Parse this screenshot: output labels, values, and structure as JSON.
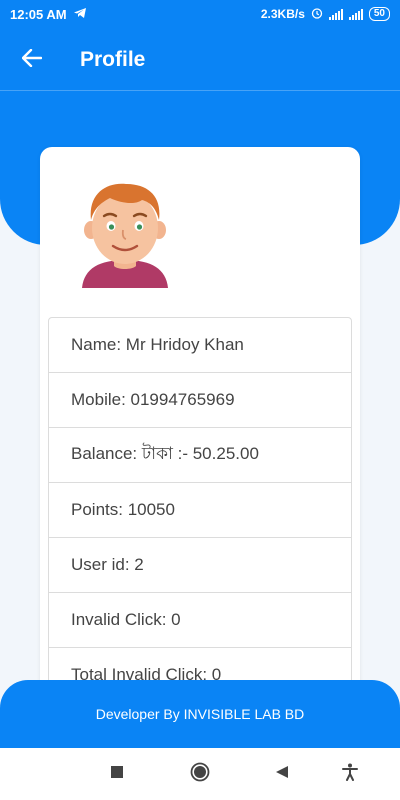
{
  "status_bar": {
    "time": "12:05 AM",
    "speed": "2.3KB/s",
    "battery": "50",
    "icons": [
      "telegram-icon",
      "alarm-icon",
      "signal-icon",
      "signal-icon",
      "battery-icon"
    ]
  },
  "app_bar": {
    "title": "Profile",
    "back_icon": "arrow-left-icon"
  },
  "profile": {
    "avatar_icon": "avatar-cartoon-boy",
    "rows": [
      "Name: Mr Hridoy Khan",
      "Mobile: 01994765969",
      "Balance: টাকা :- 50.25.00",
      "Points: 10050",
      "User id: 2",
      "Invalid Click: 0",
      "Total Invalid Click: 0"
    ]
  },
  "footer": {
    "text": "Developer By INVISIBLE LAB BD"
  },
  "nav_bar": {
    "icons": [
      "square-recents-icon",
      "circle-home-icon",
      "triangle-back-icon",
      "accessibility-icon"
    ]
  },
  "colors": {
    "primary": "#0a84f5",
    "background": "#f2f6fb",
    "card": "#ffffff",
    "text": "#444444"
  }
}
